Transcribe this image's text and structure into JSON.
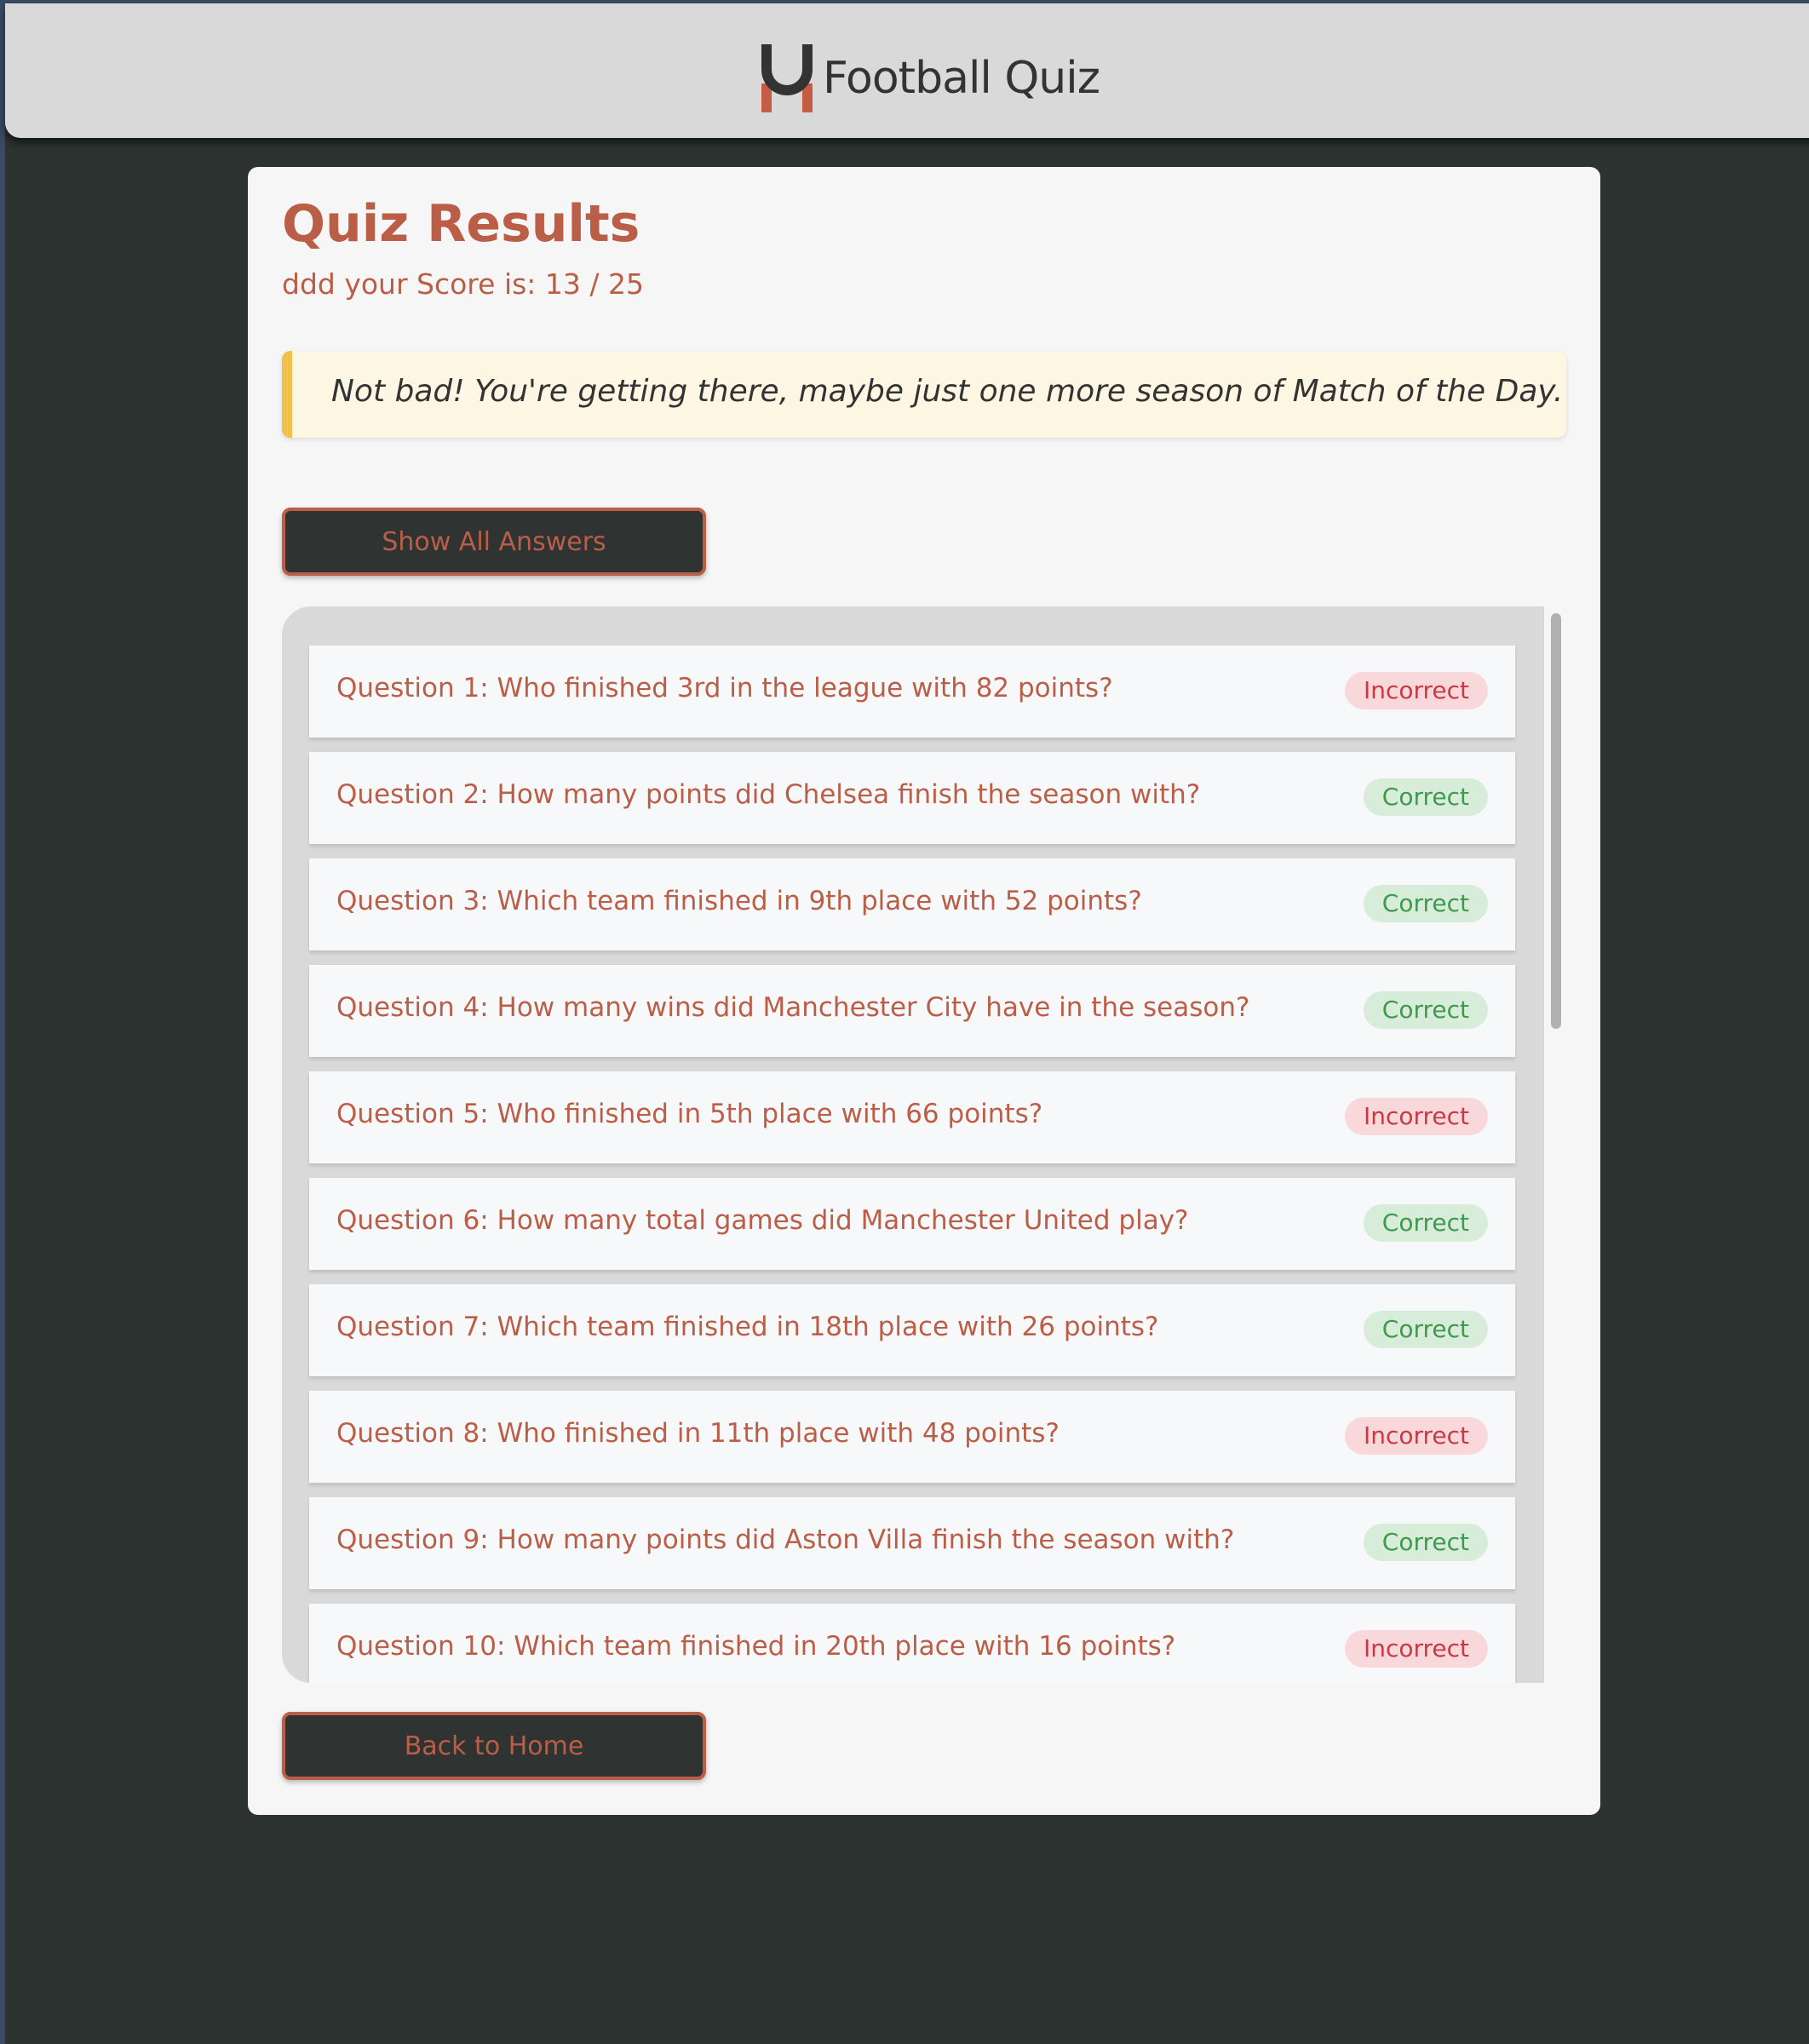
{
  "header": {
    "title": "Football Quiz",
    "logo_colors": {
      "arch": "#333333",
      "legs": "#c65c45"
    }
  },
  "results": {
    "heading": "Quiz Results",
    "score_text": "ddd your Score is: 13 / 25",
    "message": "Not bad! You're getting there, maybe just one more season of Match of the Day."
  },
  "buttons": {
    "show_all": "Show All Answers",
    "back_home": "Back to Home"
  },
  "answers": [
    {
      "question": "Question 1: Who finished 3rd in the league with 82 points?",
      "status": "Incorrect"
    },
    {
      "question": "Question 2: How many points did Chelsea finish the season with?",
      "status": "Correct"
    },
    {
      "question": "Question 3: Which team finished in 9th place with 52 points?",
      "status": "Correct"
    },
    {
      "question": "Question 4: How many wins did Manchester City have in the season?",
      "status": "Correct"
    },
    {
      "question": "Question 5: Who finished in 5th place with 66 points?",
      "status": "Incorrect"
    },
    {
      "question": "Question 6: How many total games did Manchester United play?",
      "status": "Correct"
    },
    {
      "question": "Question 7: Which team finished in 18th place with 26 points?",
      "status": "Correct"
    },
    {
      "question": "Question 8: Who finished in 11th place with 48 points?",
      "status": "Incorrect"
    },
    {
      "question": "Question 9: How many points did Aston Villa finish the season with?",
      "status": "Correct"
    },
    {
      "question": "Question 10: Which team finished in 20th place with 16 points?",
      "status": "Incorrect"
    }
  ],
  "colors": {
    "accent": "#bb5e47",
    "background": "#2c3331",
    "card": "#f6f6f6",
    "message_border": "#f0c24b",
    "correct": "#3f9a4e",
    "incorrect": "#c83a44"
  }
}
